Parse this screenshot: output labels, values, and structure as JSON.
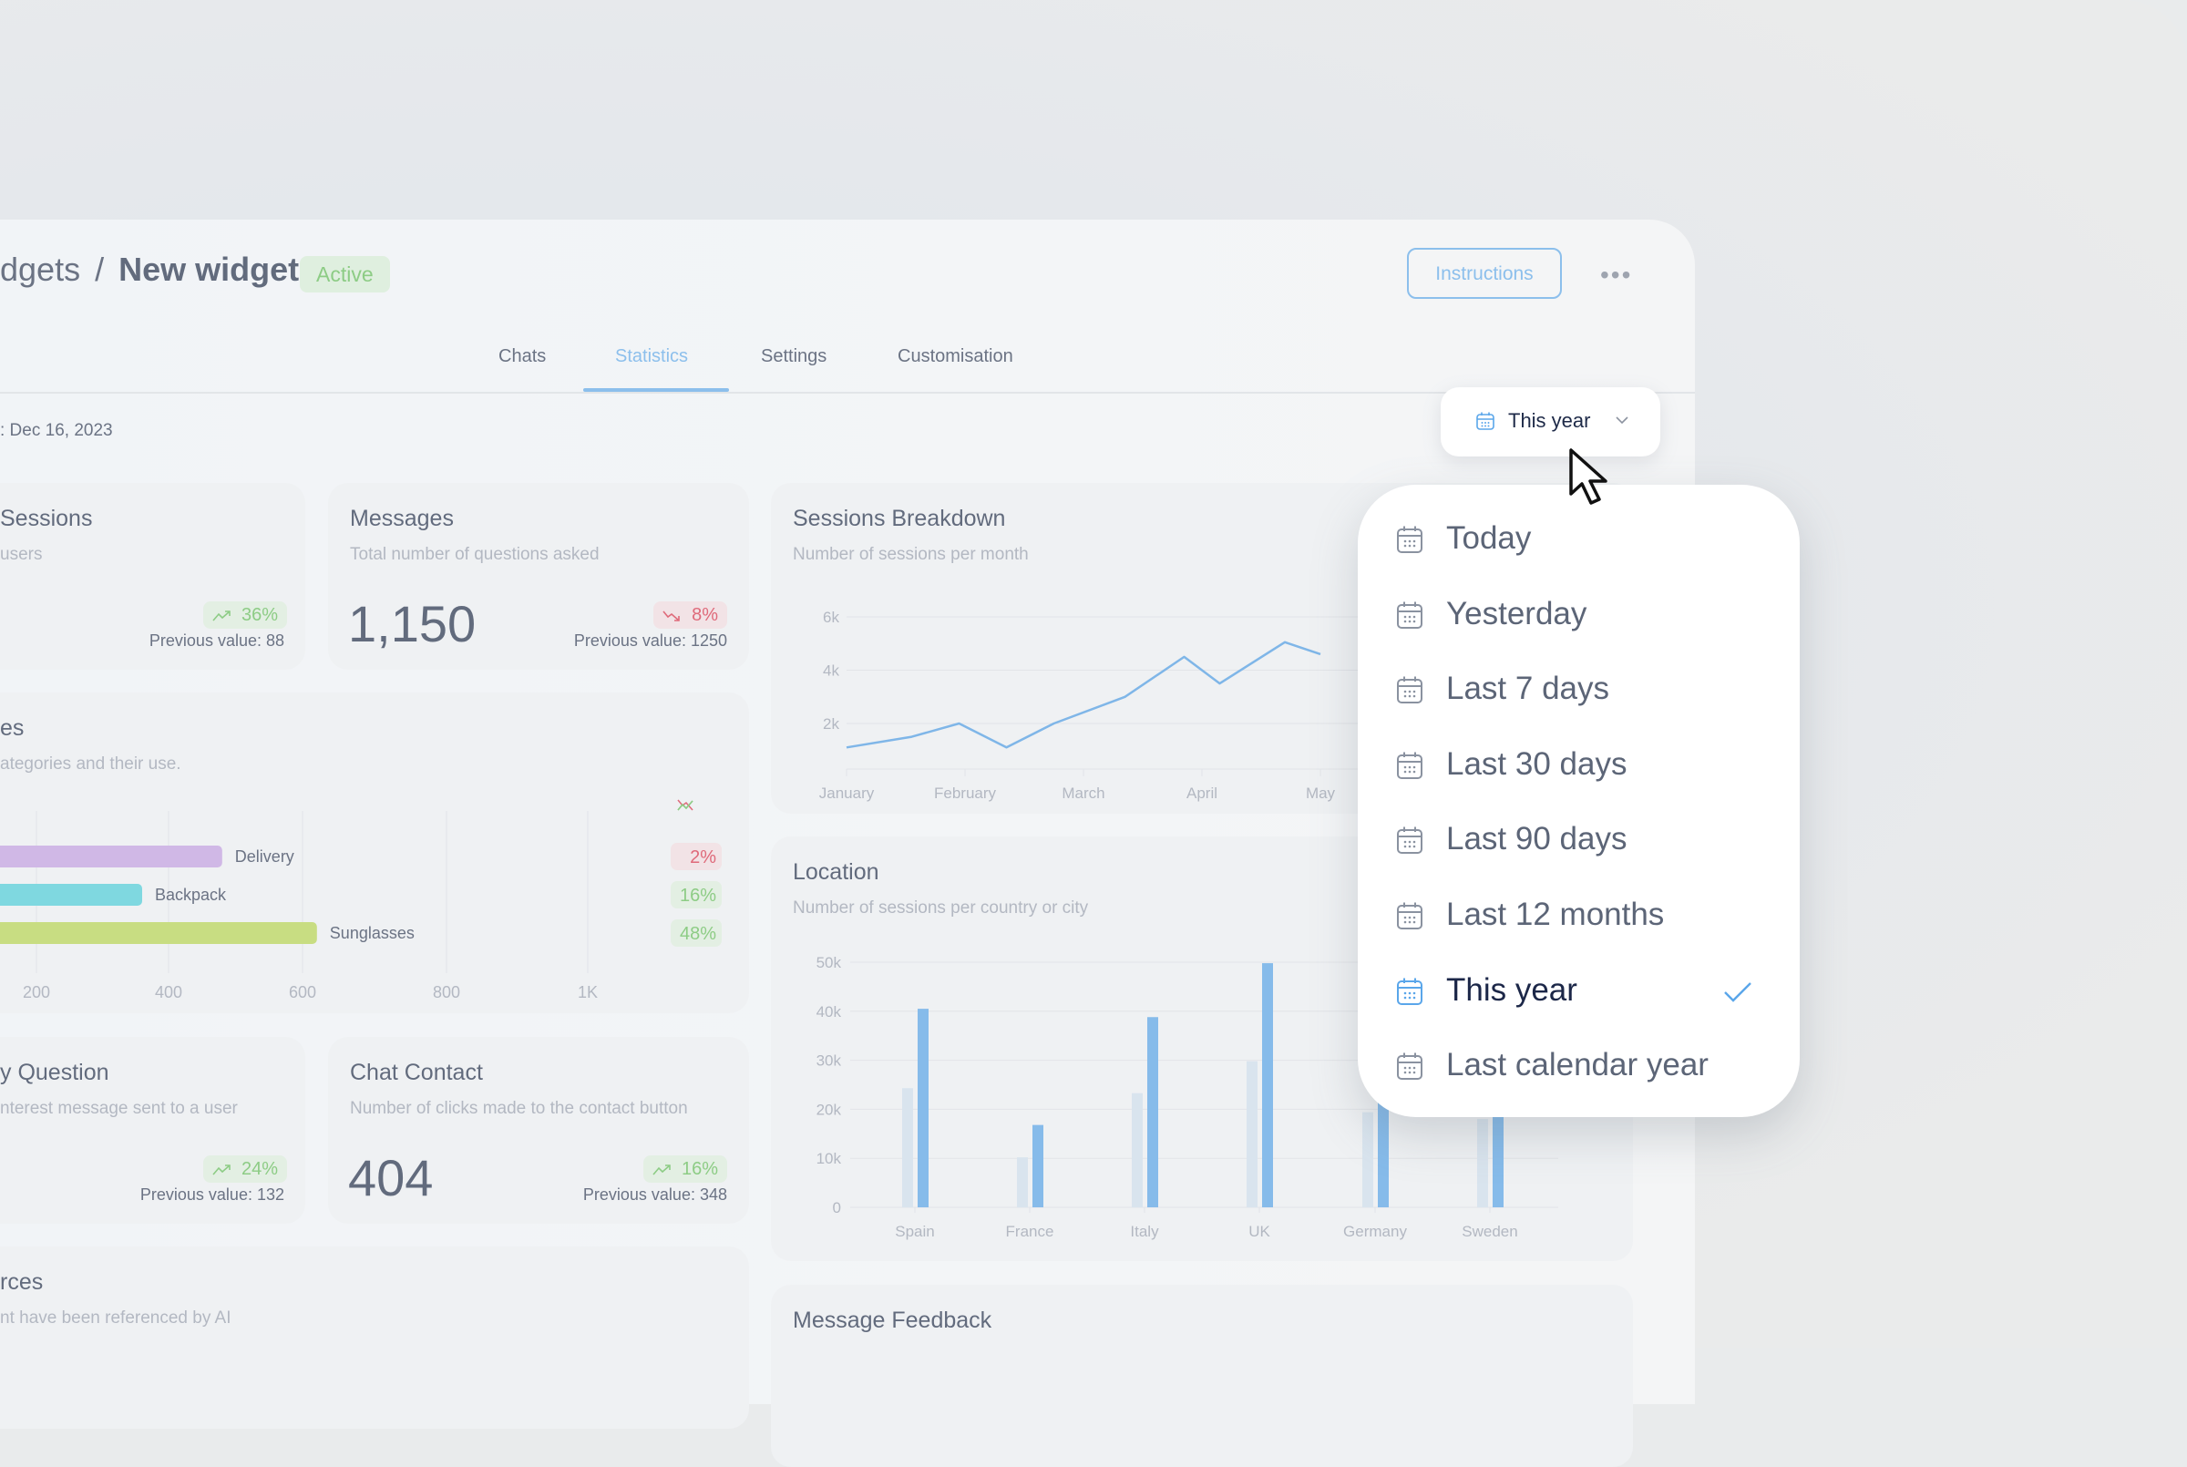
{
  "header": {
    "breadcrumb_parent": "dgets",
    "breadcrumb_separator": "/",
    "breadcrumb_current": "New widget",
    "status_badge": "Active",
    "instructions_label": "Instructions",
    "more_label": "•••"
  },
  "tabs": [
    {
      "label": "Chats",
      "active": false
    },
    {
      "label": "Statistics",
      "active": true
    },
    {
      "label": "Settings",
      "active": false
    },
    {
      "label": "Customisation",
      "active": false
    }
  ],
  "date_range_text": ":  Dec 16, 2023",
  "date_filter": {
    "selected": "This year",
    "options": [
      {
        "label": "Today",
        "selected": false
      },
      {
        "label": "Yesterday",
        "selected": false
      },
      {
        "label": "Last 7 days",
        "selected": false
      },
      {
        "label": "Last 30 days",
        "selected": false
      },
      {
        "label": "Last 90 days",
        "selected": false
      },
      {
        "label": "Last 12 months",
        "selected": false
      },
      {
        "label": "This year",
        "selected": true
      },
      {
        "label": "Last calendar year",
        "selected": false
      }
    ]
  },
  "cards": {
    "sessions": {
      "title": "Sessions",
      "subtitle": "users",
      "change": "36%",
      "trend": "up",
      "previous": "Previous value: 88"
    },
    "messages": {
      "title": "Messages",
      "subtitle": "Total number of questions asked",
      "value": "1,150",
      "change": "8%",
      "trend": "down",
      "previous": "Previous value: 1250"
    },
    "categories": {
      "title": "es",
      "subtitle": "ategories and their use."
    },
    "question": {
      "title": "y Question",
      "subtitle": "nterest message sent to a user",
      "change": "24%",
      "trend": "up",
      "previous": "Previous value: 132"
    },
    "chat_contact": {
      "title": "Chat Contact",
      "subtitle": "Number of clicks made to the contact button",
      "value": "404",
      "change": "16%",
      "trend": "up",
      "previous": "Previous value: 348"
    },
    "sources": {
      "title": "rces",
      "subtitle": "nt have been referenced by AI"
    },
    "sessions_breakdown": {
      "title": "Sessions Breakdown",
      "subtitle": "Number of sessions per month"
    },
    "location": {
      "title": "Location",
      "subtitle": "Number of sessions per country or city"
    },
    "message_feedback": {
      "title": "Message Feedback"
    }
  },
  "colors": {
    "accent": "#8cbfec",
    "up": "#8dcc85",
    "down": "#df6a7a",
    "line": "#7fb6e8",
    "bar_primary": "#86bbea",
    "bar_secondary": "#d9e4ee",
    "cat_delivery": "#d0b8e6",
    "cat_backpack": "#7fd8e0",
    "cat_sunglasses": "#c8dd82"
  },
  "chart_data": [
    {
      "type": "bar",
      "orientation": "horizontal",
      "title": "es",
      "categories": [
        "Delivery",
        "Backpack",
        "Sunglasses"
      ],
      "values": [
        480,
        360,
        620
      ],
      "changes": [
        {
          "value": "2%",
          "trend": "down"
        },
        {
          "value": "16%",
          "trend": "up"
        },
        {
          "value": "48%",
          "trend": "up"
        }
      ],
      "x_ticks": [
        "200",
        "400",
        "600",
        "800",
        "1K"
      ],
      "xlim": [
        0,
        1000
      ],
      "grid": true
    },
    {
      "type": "line",
      "title": "Sessions Breakdown",
      "subtitle": "Number of sessions per month",
      "x_ticks": [
        "January",
        "February",
        "March",
        "April",
        "May"
      ],
      "x": [
        0,
        0.55,
        0.95,
        1.35,
        1.75,
        2.35,
        2.85,
        3.15,
        3.7,
        4.0
      ],
      "values": [
        1100,
        1500,
        2000,
        1100,
        2000,
        3000,
        4500,
        3500,
        5050,
        4600
      ],
      "y_ticks": [
        "2k",
        "4k",
        "6k"
      ],
      "ylim": [
        0,
        6000
      ],
      "grid": true
    },
    {
      "type": "bar",
      "title": "Location",
      "subtitle": "Number of sessions per country or city",
      "categories": [
        "Spain",
        "France",
        "Italy",
        "UK",
        "Germany",
        "Sweden"
      ],
      "series": [
        {
          "name": "previous",
          "values": [
            24300,
            10200,
            23300,
            29800,
            19400,
            18000
          ]
        },
        {
          "name": "current",
          "values": [
            40500,
            16800,
            38800,
            49800,
            22000,
            20000
          ]
        }
      ],
      "y_ticks": [
        "0",
        "10k",
        "20k",
        "30k",
        "40k",
        "50k"
      ],
      "ylim": [
        0,
        50000
      ],
      "grid": true
    }
  ]
}
